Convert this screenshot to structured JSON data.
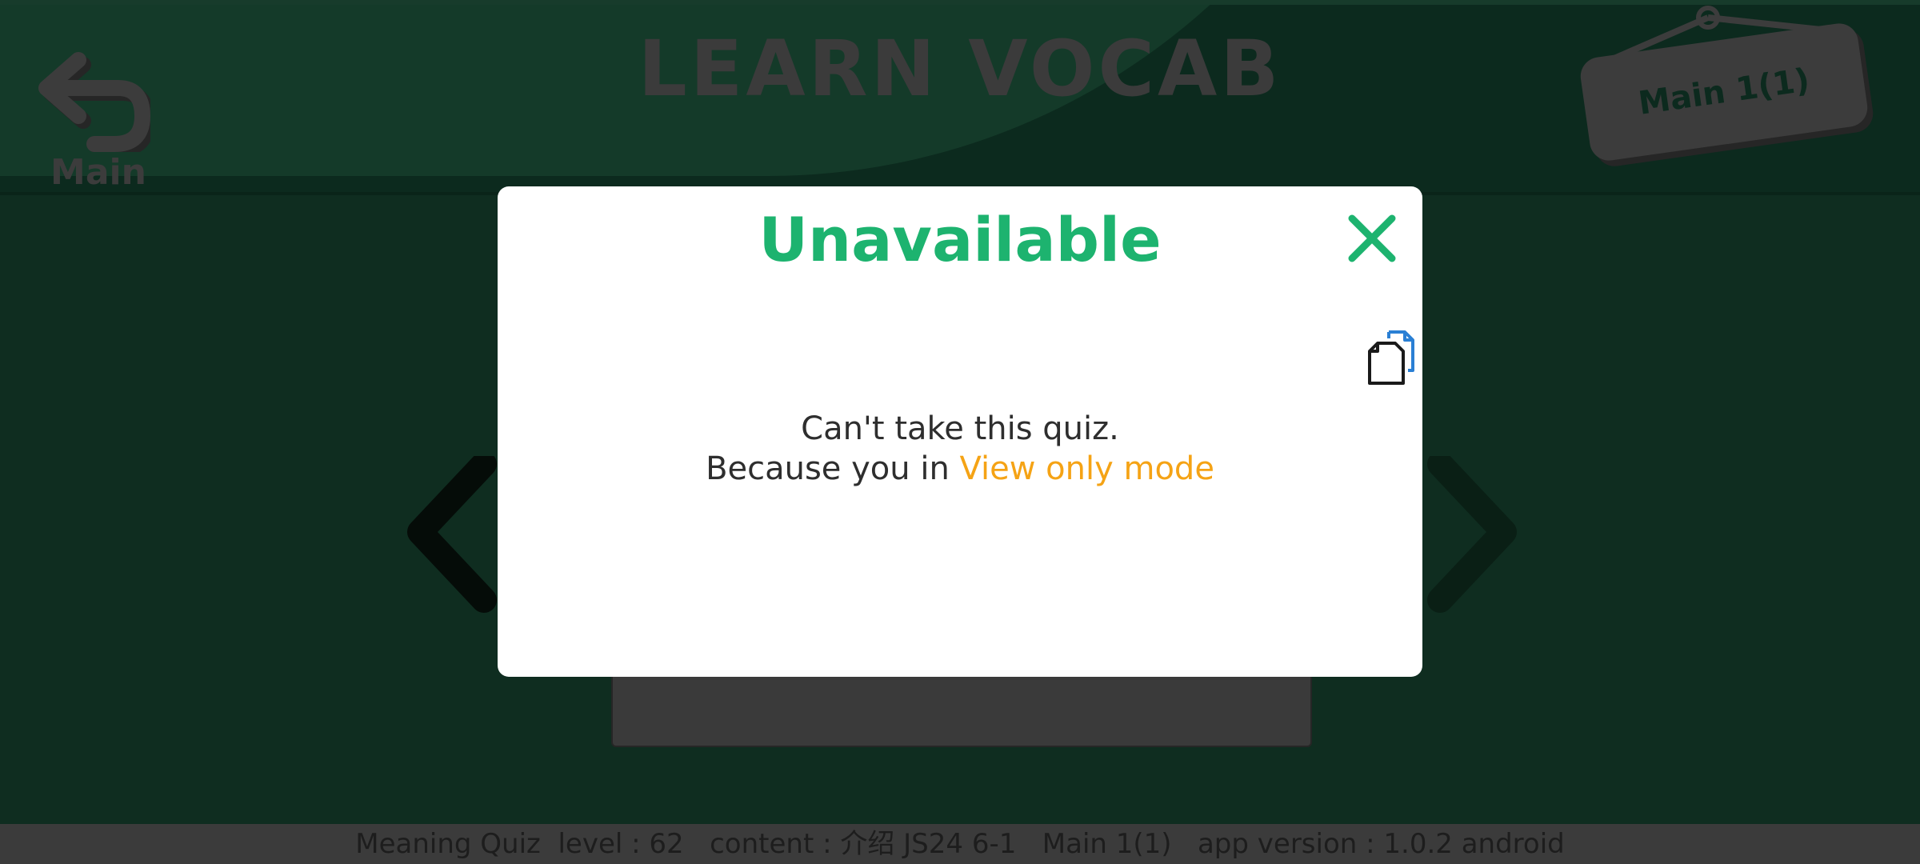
{
  "header": {
    "title": "LEARN VOCAB",
    "back_label": "Main",
    "sign_label": "Main 1(1)"
  },
  "modal": {
    "title": "Unavailable",
    "message_line1": "Can't take this quiz.",
    "message_line2_prefix": "Because you in ",
    "message_line2_highlight": "View only mode"
  },
  "footer": {
    "status_text": "Meaning Quiz  level : 62   content : 介绍 JS24 6-1   Main 1(1)   app version : 1.0.2 android"
  },
  "colors": {
    "accent_green": "#1db36f",
    "highlight_orange": "#f5a315",
    "background_green": "#0f2d20",
    "copy_icon_blue": "#2a7fd4"
  },
  "icons": {
    "back": "undo-arrow-icon",
    "close": "close-icon",
    "copy": "copy-document-icon",
    "nav_prev": "chevron-left-icon",
    "nav_next": "chevron-right-icon"
  }
}
